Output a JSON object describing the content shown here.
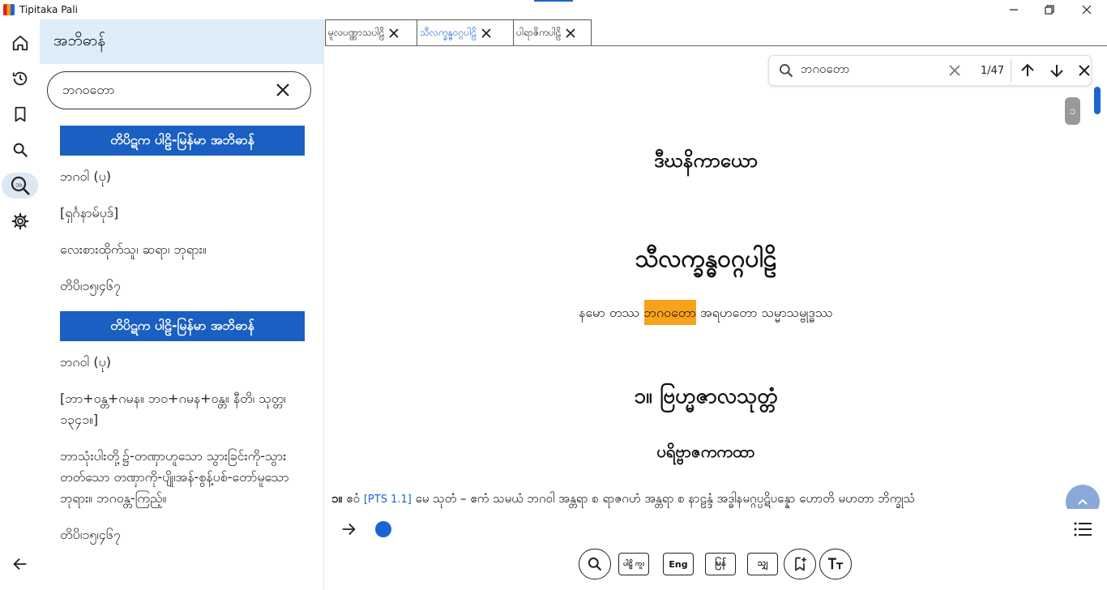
{
  "window": {
    "title": "Tipitaka Pali"
  },
  "sidebar": {
    "title": "အဘိဓာန်",
    "search": {
      "value": "ဘဂဝတော",
      "placeholder": ""
    },
    "groups": [
      {
        "heading": "တိပိဋက ပါဠိ-မြန်မာ အဘိဓာန်",
        "items": [
          "ဘဂဝါ (ပု)",
          "[ရှင်္ဂနာမ်ပုဒ်]",
          "လေးစားထိုက်သူ၊ ဆရာ၊ ဘုရား။",
          "တိပိ၊၁၅၊၄၆၇"
        ]
      },
      {
        "heading": "တိပိဋက ပါဠိ-မြန်မာ အဘိဓာန်",
        "items": [
          "ဘဂဝါ (ပု)",
          "[ဘာ+ဝန္တ+ဂမန။ ဘဝ+ဂမန+ဝန္တ။ နီတိ၊ သုတ္တ၊ ၁၃၄၁။]",
          "ဘာသုံးပါးတို့၌-တဏှာဟူသော သွားခြင်းကို-သွားတတ်သော တဏှာကို-ပျို၊အန်-စွန့်ပစ်-တော်မူသော ဘုရား။ ဘဂဝန္တ-ကြည့်။",
          "တိပိ၊၁၅၊၄၆၇"
        ]
      }
    ]
  },
  "tabs": [
    {
      "label": "မူလပဏ္ဏာသပါဠိ",
      "active": false
    },
    {
      "label": "သီလက္ခန္ဓဝဂ္ဂပါဠိ",
      "active": true
    },
    {
      "label": "ပါရာဇိကပါဠိ",
      "active": false
    }
  ],
  "find": {
    "value": "ဘဂဝတော",
    "count": "1/47"
  },
  "reader": {
    "page_badge": "၁",
    "title1": "ဒီဃနိကာယော",
    "title2": "သီလက္ခန္ဓဝဂ္ဂပါဠိ",
    "namo_before": "နမော တဿ ",
    "namo_highlight": "ဘဂဝတော",
    "namo_after": " အရဟတော သမ္မာသမ္ဗုဒ္ဓဿ",
    "title3": "၁။ ဗြဟ္မဇာလသုတ္တံ",
    "title4": "ပရိဗ္ဗာဇကကထာ",
    "para_num": "၁။ ",
    "para_lead": "ဧဝံ ",
    "para_ref": "[PTS 1.1]",
    "para_text": " မေ သုတံ – ဧကံ သမယံ ဘဂဝါ အန္တရာ စ ရာဇဂဟံ အန္တရာ စ နာဠန္ဒံ အဒ္ဓါနမဂ္ဂပ္ပဋိပန္နော ဟောတိ မဟတာ ဘိက္ခုသံ"
  },
  "toolbar": {
    "pali_label": "ပါဠိ ကူး",
    "eng_label": "Eng",
    "mya_label": "မြန်",
    "sinh_label": "သျှ"
  }
}
